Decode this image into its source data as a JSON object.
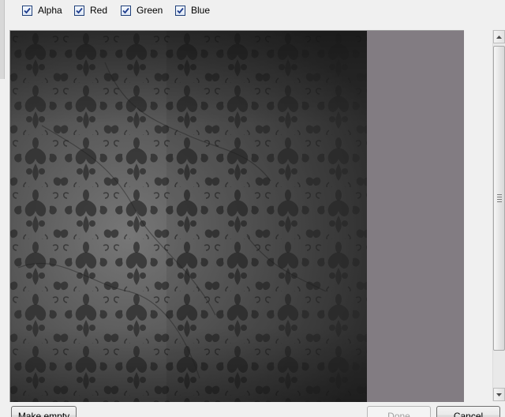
{
  "channels": [
    {
      "label": "Alpha",
      "checked": true
    },
    {
      "label": "Red",
      "checked": true
    },
    {
      "label": "Green",
      "checked": true
    },
    {
      "label": "Blue",
      "checked": true
    }
  ],
  "preview": {
    "background_color": "#827c82",
    "texture_base_color": "#4a4a4a"
  },
  "buttons": {
    "make_empty": "Make empty",
    "done": "Done",
    "cancel": "Cancel"
  }
}
